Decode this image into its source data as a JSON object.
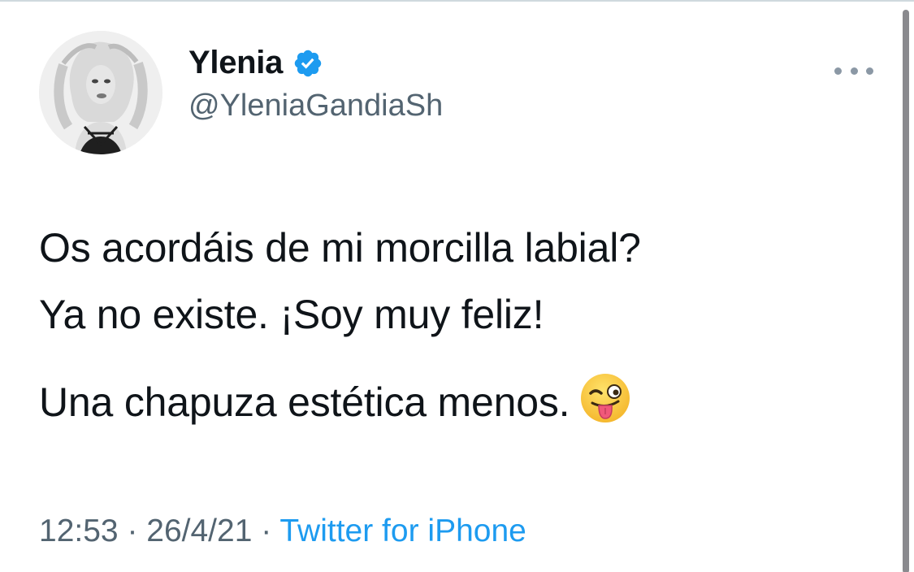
{
  "tweet": {
    "author": {
      "display_name": "Ylenia",
      "handle": "@YleniaGandiaSh",
      "verified": true,
      "avatar_icon": "profile-photo"
    },
    "more_icon": "more-horizontal-icon",
    "text": {
      "line1": "Os acordáis de mi morcilla labial?",
      "line2": "Ya no existe. ¡Soy muy feliz!",
      "line3": "Una chapuza estética menos.",
      "emoji": "winking-face-with-tongue"
    },
    "meta": {
      "time": "12:53",
      "separator1": " · ",
      "date": "26/4/21",
      "separator2": " · ",
      "source": "Twitter for iPhone"
    }
  },
  "colors": {
    "accent": "#1d9bf0",
    "text_primary": "#0f1419",
    "text_secondary": "#536471"
  }
}
